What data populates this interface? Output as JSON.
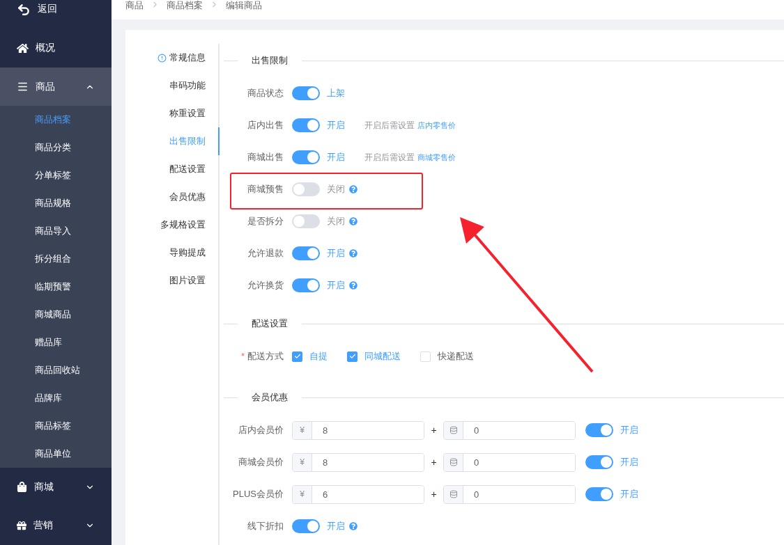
{
  "sidebar": {
    "back": "返回",
    "items": [
      {
        "label": "概况",
        "expanded": false,
        "has_caret": false
      },
      {
        "label": "商品",
        "expanded": true,
        "has_caret": true,
        "children": [
          {
            "label": "商品档案",
            "selected": true
          },
          {
            "label": "商品分类",
            "selected": false
          },
          {
            "label": "分单标签",
            "selected": false
          },
          {
            "label": "商品规格",
            "selected": false
          },
          {
            "label": "商品导入",
            "selected": false
          },
          {
            "label": "拆分组合",
            "selected": false
          },
          {
            "label": "临期预警",
            "selected": false
          },
          {
            "label": "商城商品",
            "selected": false
          },
          {
            "label": "赠品库",
            "selected": false
          },
          {
            "label": "商品回收站",
            "selected": false
          },
          {
            "label": "品牌库",
            "selected": false
          },
          {
            "label": "商品标签",
            "selected": false
          },
          {
            "label": "商品单位",
            "selected": false
          }
        ]
      },
      {
        "label": "商城",
        "expanded": false,
        "has_caret": true
      },
      {
        "label": "营销",
        "expanded": false,
        "has_caret": true
      }
    ]
  },
  "breadcrumb": [
    "商品",
    "商品档案",
    "编辑商品"
  ],
  "anchor_nav": [
    {
      "label": "常规信息",
      "selected": false,
      "warning": true
    },
    {
      "label": "串码功能",
      "selected": false,
      "warning": false
    },
    {
      "label": "称重设置",
      "selected": false,
      "warning": false
    },
    {
      "label": "出售限制",
      "selected": true,
      "warning": false
    },
    {
      "label": "配送设置",
      "selected": false,
      "warning": false
    },
    {
      "label": "会员优惠",
      "selected": false,
      "warning": false
    },
    {
      "label": "多规格设置",
      "selected": false,
      "warning": false
    },
    {
      "label": "导购提成",
      "selected": false,
      "warning": false
    },
    {
      "label": "图片设置",
      "selected": false,
      "warning": false
    }
  ],
  "sections": [
    {
      "title": "出售限制",
      "rows": [
        {
          "kind": "switch",
          "label": "商品状态",
          "on": true,
          "state_text": "上架",
          "help": false,
          "highlighted": false
        },
        {
          "kind": "switch",
          "label": "店内出售",
          "on": true,
          "state_text": "开启",
          "help": false,
          "note": "开启后需设置",
          "link": "店内零售价",
          "highlighted": false
        },
        {
          "kind": "switch",
          "label": "商城出售",
          "on": true,
          "state_text": "开启",
          "help": false,
          "note": "开启后需设置",
          "link": "商城零售价",
          "highlighted": false
        },
        {
          "kind": "switch",
          "label": "商城预售",
          "on": false,
          "state_text": "关闭",
          "help": true,
          "highlighted": true
        },
        {
          "kind": "switch",
          "label": "是否拆分",
          "on": false,
          "state_text": "关闭",
          "help": true,
          "highlighted": false
        },
        {
          "kind": "switch",
          "label": "允许退款",
          "on": true,
          "state_text": "开启",
          "help": true,
          "highlighted": false
        },
        {
          "kind": "switch",
          "label": "允许换货",
          "on": true,
          "state_text": "开启",
          "help": true,
          "highlighted": false
        }
      ]
    },
    {
      "title": "配送设置",
      "rows": [
        {
          "kind": "checkboxes",
          "label": "配送方式",
          "required_mark": "*",
          "options": [
            {
              "label": "自提",
              "checked": true
            },
            {
              "label": "同城配送",
              "checked": true
            },
            {
              "label": "快递配送",
              "checked": false
            }
          ]
        }
      ]
    },
    {
      "title": "会员优惠",
      "rows": [
        {
          "kind": "price",
          "label": "店内会员价",
          "currency": "¥",
          "price": "8",
          "plus": "+",
          "points": "0",
          "on": true,
          "state_text": "开启"
        },
        {
          "kind": "price",
          "label": "商城会员价",
          "currency": "¥",
          "price": "8",
          "plus": "+",
          "points": "0",
          "on": true,
          "state_text": "开启"
        },
        {
          "kind": "price",
          "label": "PLUS会员价",
          "currency": "¥",
          "price": "6",
          "plus": "+",
          "points": "0",
          "on": true,
          "state_text": "开启"
        },
        {
          "kind": "switch",
          "label": "线下折扣",
          "on": true,
          "state_text": "开启",
          "help": true,
          "highlighted": false
        }
      ]
    }
  ]
}
